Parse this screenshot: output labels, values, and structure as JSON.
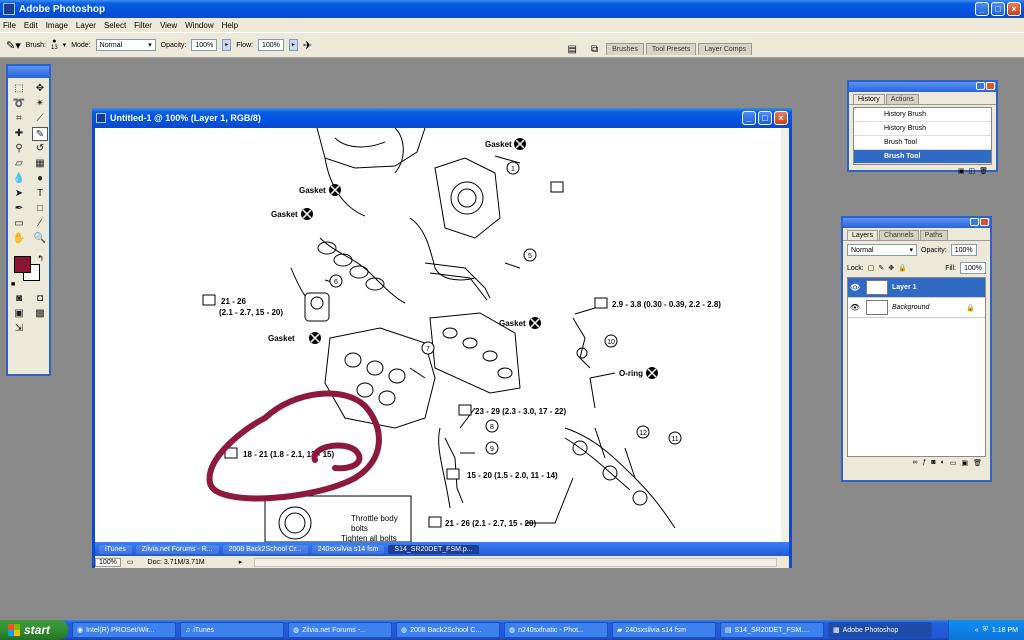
{
  "app": {
    "title": "Adobe Photoshop",
    "menus": [
      "File",
      "Edit",
      "Image",
      "Layer",
      "Select",
      "Filter",
      "View",
      "Window",
      "Help"
    ]
  },
  "options_bar": {
    "brush_label": "Brush:",
    "brush_size": "13",
    "mode_label": "Mode:",
    "mode_value": "Normal",
    "opacity_label": "Opacity:",
    "opacity_value": "100%",
    "flow_label": "Flow:",
    "flow_value": "100%",
    "palette_tabs": [
      "Brushes",
      "Tool Presets",
      "Layer Comps"
    ]
  },
  "document": {
    "title": "Untitled-1 @ 100% (Layer 1, RGB/8)",
    "zoom": "100%",
    "doc_size": "Doc: 3.71M/3.71M",
    "inner_tasks": [
      "iTunes",
      "Zilvia.net Forums - R...",
      "2008 Back2School Cr...",
      "240sxsilvia s14 fsm",
      "S14_SR20DET_FSM.p..."
    ]
  },
  "diagram": {
    "labels": [
      "Gasket",
      "Gasket",
      "Gasket",
      "Gasket",
      "Gasket",
      "21 - 26",
      "(2.1 - 2.7, 15 - 20)",
      "2.9 - 3.8 (0.30 - 0.39, 2.2 - 2.8)",
      "O-ring",
      "23 - 29 (2.3 - 3.0, 17 - 22)",
      "18 - 21 (1.8 - 2.1, 13 - 15)",
      "15 - 20 (1.5 - 2.0, 11 - 14)",
      "21 - 26 (2.1 - 2.7, 15 - 20)",
      "Throttle body",
      "bolts",
      "Tighten all bolts"
    ],
    "callouts": [
      "1",
      "3",
      "5",
      "6",
      "7",
      "8",
      "9",
      "10",
      "11",
      "12"
    ]
  },
  "history": {
    "tabs": [
      "History",
      "Actions"
    ],
    "items": [
      "History Brush",
      "History Brush",
      "Brush Tool",
      "Brush Tool"
    ]
  },
  "layers": {
    "tabs": [
      "Layers",
      "Channels",
      "Paths"
    ],
    "blend_mode": "Normal",
    "opacity_label": "Opacity:",
    "opacity_value": "100%",
    "lock_label": "Lock:",
    "fill_label": "Fill:",
    "fill_value": "100%",
    "items": [
      "Layer 1",
      "Background"
    ]
  },
  "taskbar": {
    "start": "start",
    "items": [
      "Intel(R) PROSet/Wir...",
      "iTunes",
      "Zilvia.net Forums -...",
      "2008 Back2School C...",
      "n240sxfnatic - Phot...",
      "240sxsilvia s14 fsm",
      "S14_SR20DET_FSM....",
      "Adobe Photoshop"
    ],
    "clock": "1:18 PM"
  },
  "colors": {
    "foreground": "#8d1333",
    "background": "#ffffff",
    "annotation": "#8d1a3a"
  }
}
